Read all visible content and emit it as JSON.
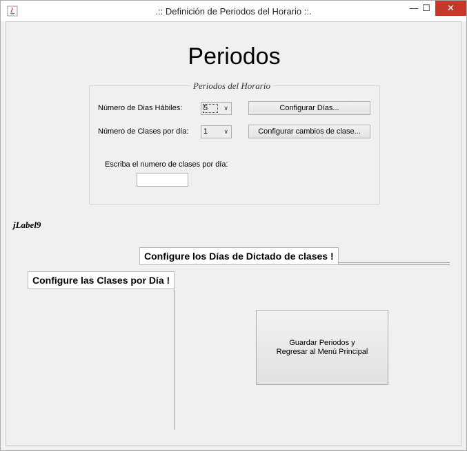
{
  "window": {
    "title": ".:: Definición de Periodos del Horario ::.",
    "min": "—",
    "max": "☐",
    "close": "✕"
  },
  "heading": "Periodos",
  "group": {
    "legend": "Periodos del Horario",
    "dias_label": "Número de Dias Hábiles:",
    "dias_value": "5",
    "config_dias_button": "Configurar Días...",
    "clases_label": "Número de Clases por día:",
    "clases_value": "1",
    "config_cambios_button": "Configurar cambios de clase...",
    "escriba_label": "Escriba el numero de clases por día:",
    "clases_input_value": ""
  },
  "jlabel9": "jLabel9",
  "tab_dias": "Configure los Días de Dictado de clases !",
  "tab_clases": "Configure las Clases por Día !",
  "save_button": {
    "line1": "Guardar Periodos y",
    "line2": "Regresar al Menú Principal"
  }
}
